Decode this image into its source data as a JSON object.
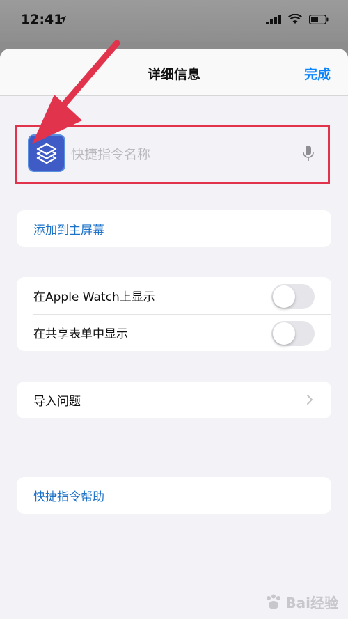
{
  "status_bar": {
    "time": "12:41",
    "icons": [
      "location-arrow-icon",
      "signal-icon",
      "wifi-icon",
      "battery-icon"
    ]
  },
  "nav": {
    "title": "详细信息",
    "done_label": "完成"
  },
  "shortcut": {
    "icon": "shortcuts-layers-icon",
    "name_value": "",
    "name_placeholder": "快捷指令名称"
  },
  "actions": {
    "add_to_home": "添加到主屏幕"
  },
  "toggles": [
    {
      "label": "在Apple Watch上显示",
      "on": false
    },
    {
      "label": "在共享表单中显示",
      "on": false
    }
  ],
  "import": {
    "label": "导入问题"
  },
  "help": {
    "label": "快捷指令帮助"
  },
  "colors": {
    "accent": "#0a84ff",
    "link": "#1e73c8",
    "annotation": "#e2334d",
    "shortcut_icon_bg": "#3f5bc6"
  },
  "watermark": {
    "text": "Bai经验"
  }
}
